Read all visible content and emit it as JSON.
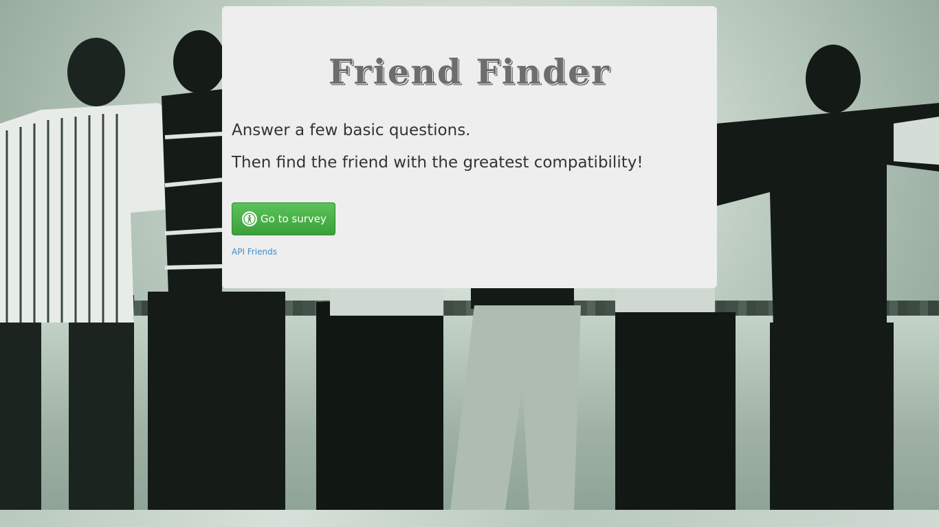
{
  "page": {
    "title": "Friend Finder"
  },
  "hero": {
    "line1": "Answer a few basic questions.",
    "line2": "Then find the friend with the greatest compatibility!"
  },
  "actions": {
    "survey_button_label": "Go to survey",
    "survey_button_icon": "accessibility-icon",
    "api_link_label": "API Friends"
  },
  "colors": {
    "card_background": "#eeeeee",
    "button_green": "#3aa13a",
    "link_blue": "#428bca",
    "title_gray": "#6d6d6d"
  }
}
